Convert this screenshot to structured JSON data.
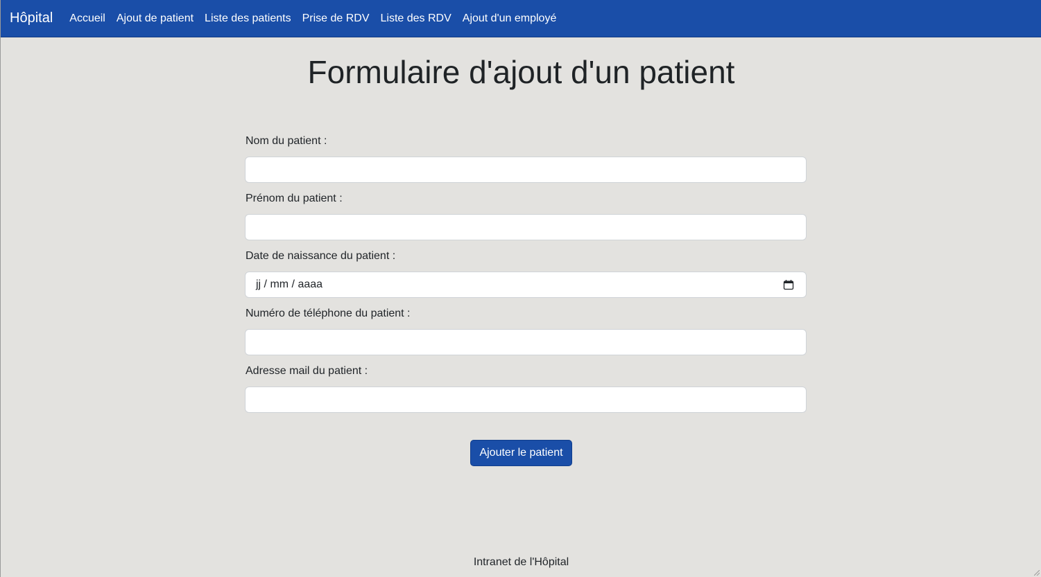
{
  "navbar": {
    "brand": "Hôpital",
    "links": [
      {
        "label": "Accueil"
      },
      {
        "label": "Ajout de patient"
      },
      {
        "label": "Liste des patients"
      },
      {
        "label": "Prise de RDV"
      },
      {
        "label": "Liste des RDV"
      },
      {
        "label": "Ajout d'un employé"
      }
    ],
    "background_color": "#1a4ea8"
  },
  "page": {
    "title": "Formulaire d'ajout d'un patient",
    "background_color": "#e3e2df"
  },
  "form": {
    "fields": [
      {
        "label": "Nom du patient :",
        "value": ""
      },
      {
        "label": "Prénom du patient :",
        "value": ""
      },
      {
        "label": "Date de naissance du patient :",
        "placeholder": "jj / mm / aaaa",
        "icon": "calendar-icon"
      },
      {
        "label": "Numéro de téléphone du patient :",
        "value": ""
      },
      {
        "label": "Adresse mail du patient :",
        "value": ""
      }
    ],
    "submit_label": "Ajouter le patient"
  },
  "footer": {
    "text": "Intranet de l'Hôpital"
  }
}
